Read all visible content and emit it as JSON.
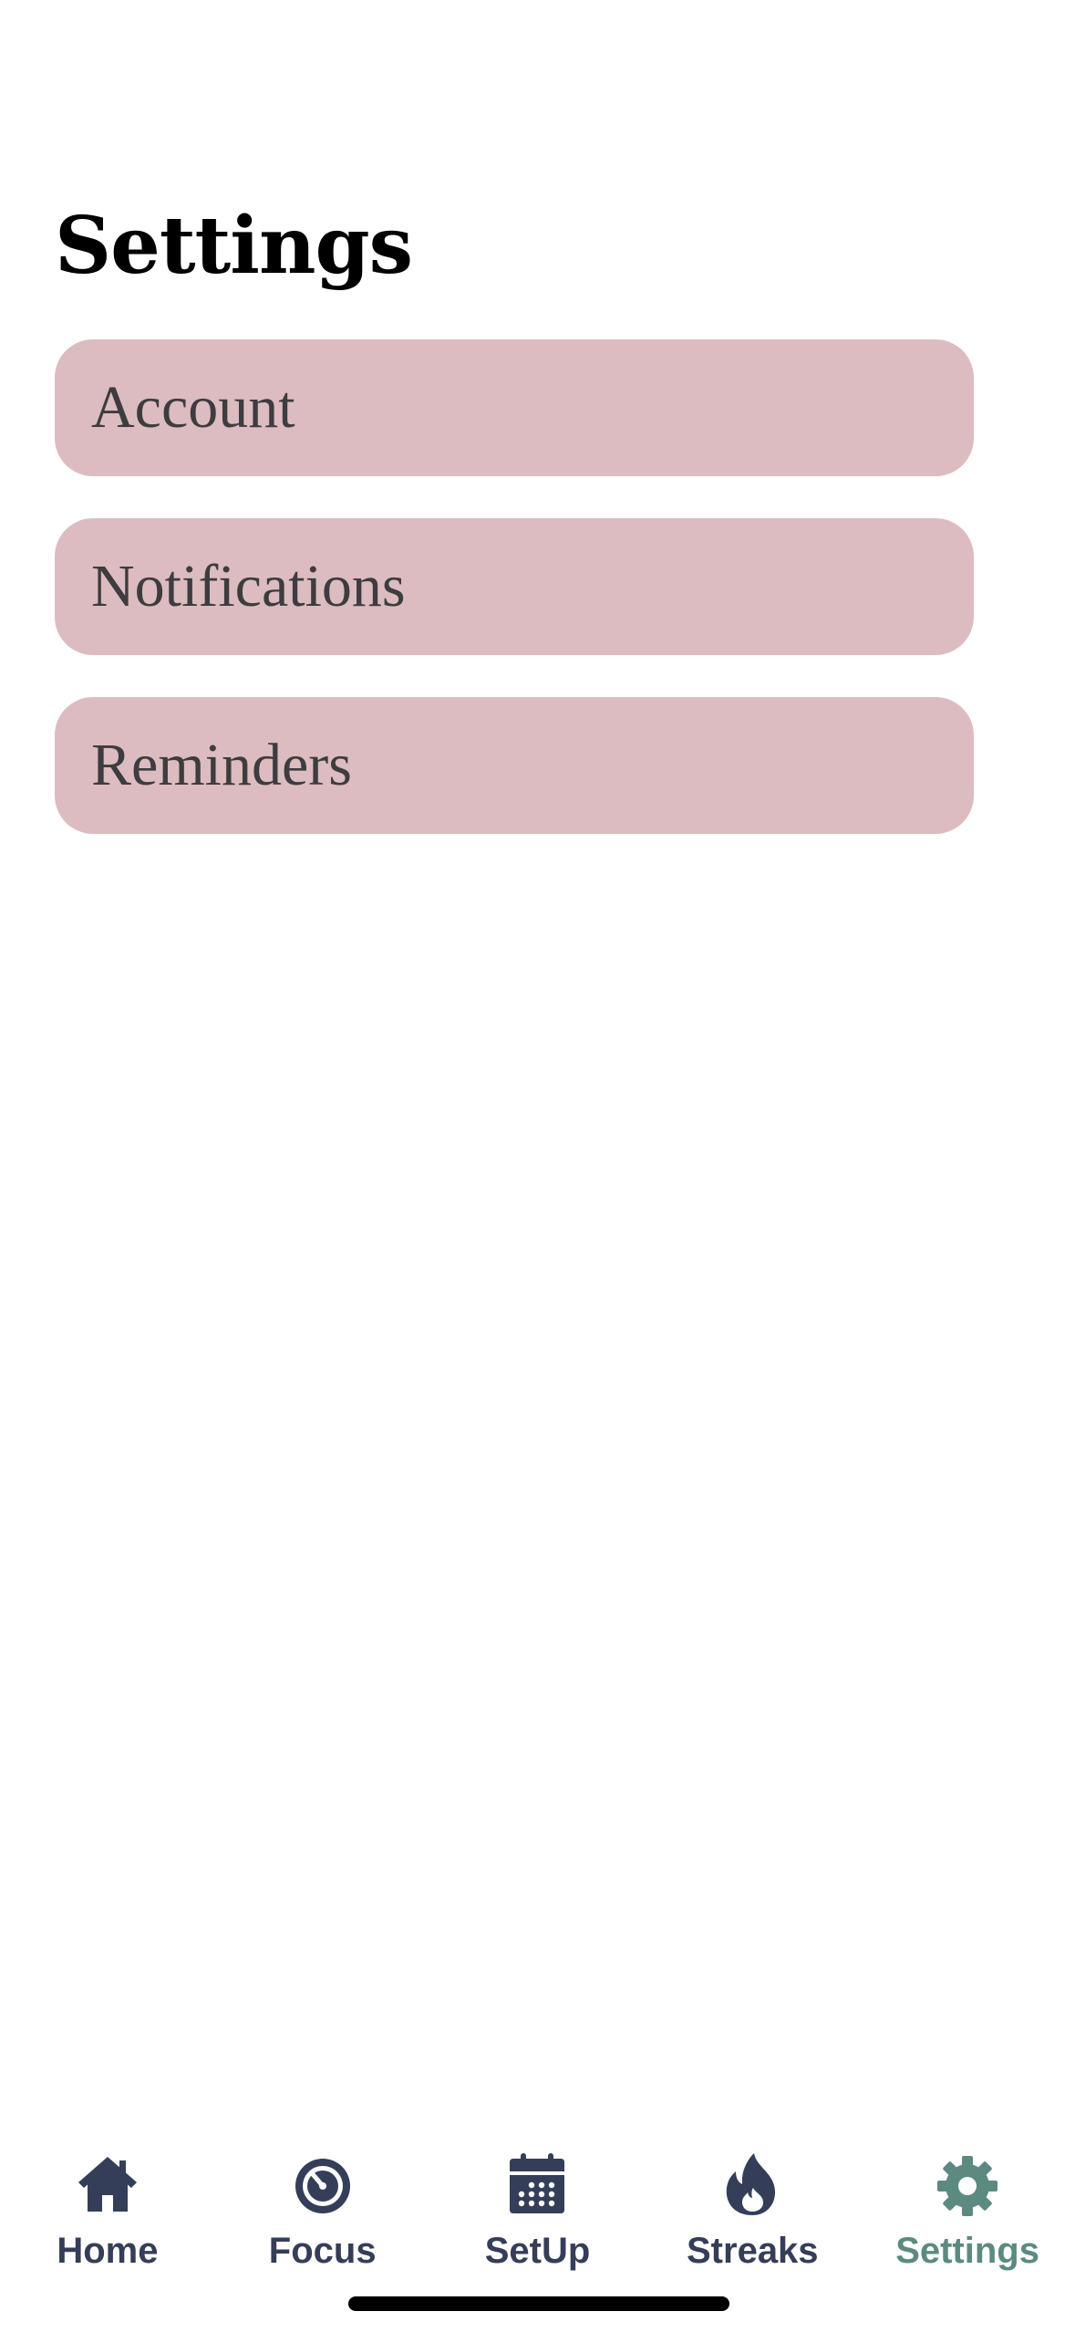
{
  "page": {
    "title": "Settings"
  },
  "settings_items": [
    {
      "label": "Account"
    },
    {
      "label": "Notifications"
    },
    {
      "label": "Reminders"
    }
  ],
  "tab_bar": {
    "tabs": [
      {
        "label": "Home",
        "icon": "home-icon",
        "active": false
      },
      {
        "label": "Focus",
        "icon": "timer-icon",
        "active": false
      },
      {
        "label": "SetUp",
        "icon": "calendar-icon",
        "active": false
      },
      {
        "label": "Streaks",
        "icon": "flame-icon",
        "active": false
      },
      {
        "label": "Settings",
        "icon": "gear-icon",
        "active": true
      }
    ],
    "colors": {
      "inactive": "#353e58",
      "active": "#5c8a80"
    }
  },
  "colors": {
    "row_background": "#dcbcc0",
    "row_text": "#3d3c3f",
    "title": "#000000"
  }
}
